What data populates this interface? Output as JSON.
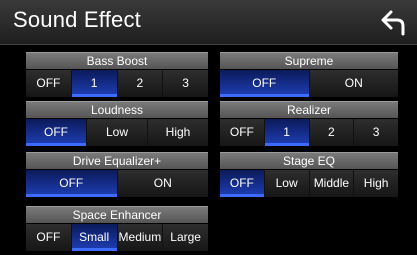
{
  "title": "Sound Effect",
  "back_icon": "back-arrow-icon",
  "accent_color": "#2c4fd6",
  "panels": {
    "bass_boost": {
      "label": "Bass Boost",
      "options": [
        "OFF",
        "1",
        "2",
        "3"
      ],
      "selected": "1"
    },
    "loudness": {
      "label": "Loudness",
      "options": [
        "OFF",
        "Low",
        "High"
      ],
      "selected": "OFF"
    },
    "drive_eq": {
      "label": "Drive Equalizer+",
      "options": [
        "OFF",
        "ON"
      ],
      "selected": "OFF"
    },
    "space_enhancer": {
      "label": "Space Enhancer",
      "options": [
        "OFF",
        "Small",
        "Medium",
        "Large"
      ],
      "selected": "Small"
    },
    "supreme": {
      "label": "Supreme",
      "options": [
        "OFF",
        "ON"
      ],
      "selected": "OFF"
    },
    "realizer": {
      "label": "Realizer",
      "options": [
        "OFF",
        "1",
        "2",
        "3"
      ],
      "selected": "1"
    },
    "stage_eq": {
      "label": "Stage EQ",
      "options": [
        "OFF",
        "Low",
        "Middle",
        "High"
      ],
      "selected": "OFF"
    }
  }
}
